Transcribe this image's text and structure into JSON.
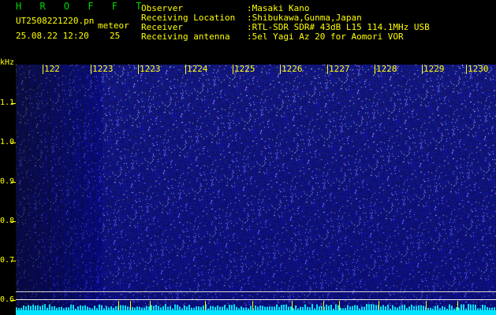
{
  "header": {
    "title": "H R O F F T",
    "filename": "UT2508221220.pn",
    "meteor_label": "meteor",
    "datetime": "25.08.22 12:20",
    "count": "25",
    "info": [
      {
        "key": "Observer",
        "value": ":Masaki Kano"
      },
      {
        "key": "Receiving Location",
        "value": ":Shibukawa,Gunma,Japan"
      },
      {
        "key": "Receiver",
        "value": ":RTL-SDR SDR# 43dB L15 114.1MHz USB"
      },
      {
        "key": "Receiving antenna",
        "value": ":5el Yagi Az 20 for Aomori VOR"
      }
    ]
  },
  "yaxis": {
    "unit": "kHz",
    "labels": [
      "1.1",
      "1.0",
      "0.9",
      "0.8",
      "0.7",
      "0.6"
    ]
  },
  "xaxis": {
    "labels": [
      "122",
      "1223",
      "1223",
      "1224",
      "1225",
      "1226",
      "1227",
      "1228",
      "1229",
      "1230"
    ]
  },
  "colors": {
    "background": "#000000",
    "text_yellow": "#ffff00",
    "title_green": "#00d800",
    "waterfall_base": "#0a0e6e",
    "spectrum": "#00e5ff"
  }
}
